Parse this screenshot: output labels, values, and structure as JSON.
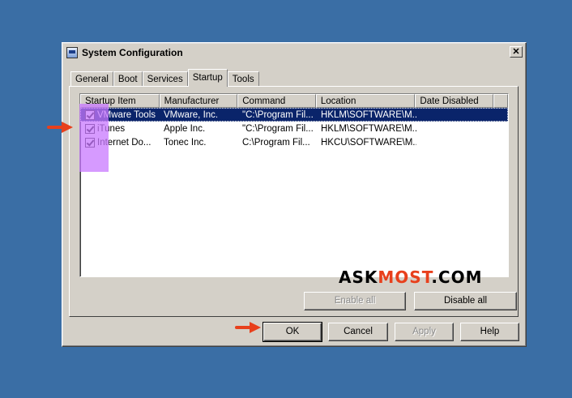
{
  "window": {
    "title": "System Configuration",
    "close_glyph": "✕"
  },
  "tabs": [
    {
      "label": "General"
    },
    {
      "label": "Boot"
    },
    {
      "label": "Services"
    },
    {
      "label": "Startup"
    },
    {
      "label": "Tools"
    }
  ],
  "active_tab": "Startup",
  "list": {
    "columns": [
      "Startup Item",
      "Manufacturer",
      "Command",
      "Location",
      "Date Disabled"
    ],
    "rows": [
      {
        "item": "VMware Tools",
        "manufacturer": "VMware, Inc.",
        "command": "\"C:\\Program Fil...",
        "location": "HKLM\\SOFTWARE\\M...",
        "date_disabled": "",
        "checked": true,
        "selected": true
      },
      {
        "item": "iTunes",
        "manufacturer": "Apple Inc.",
        "command": "\"C:\\Program Fil...",
        "location": "HKLM\\SOFTWARE\\M...",
        "date_disabled": "",
        "checked": true,
        "selected": false
      },
      {
        "item": "Internet Do...",
        "manufacturer": "Tonec Inc.",
        "command": "C:\\Program Fil...",
        "location": "HKCU\\SOFTWARE\\M...",
        "date_disabled": "",
        "checked": true,
        "selected": false
      }
    ]
  },
  "panel_buttons": {
    "enable_all": "Enable all",
    "disable_all": "Disable all"
  },
  "dialog_buttons": {
    "ok": "OK",
    "cancel": "Cancel",
    "apply": "Apply",
    "help": "Help"
  },
  "watermark": {
    "part1": "ASK",
    "part2": "MOST",
    "part3": ".COM"
  },
  "colors": {
    "desktop": "#3a6ea5",
    "selection": "#0a246a",
    "annotation_arrow": "#e8401c",
    "annotation_highlight": "#c878ff"
  },
  "icons": {
    "app": "system-config-icon",
    "checkbox": "checkbox-checked-icon",
    "arrow": "red-arrow-icon"
  }
}
